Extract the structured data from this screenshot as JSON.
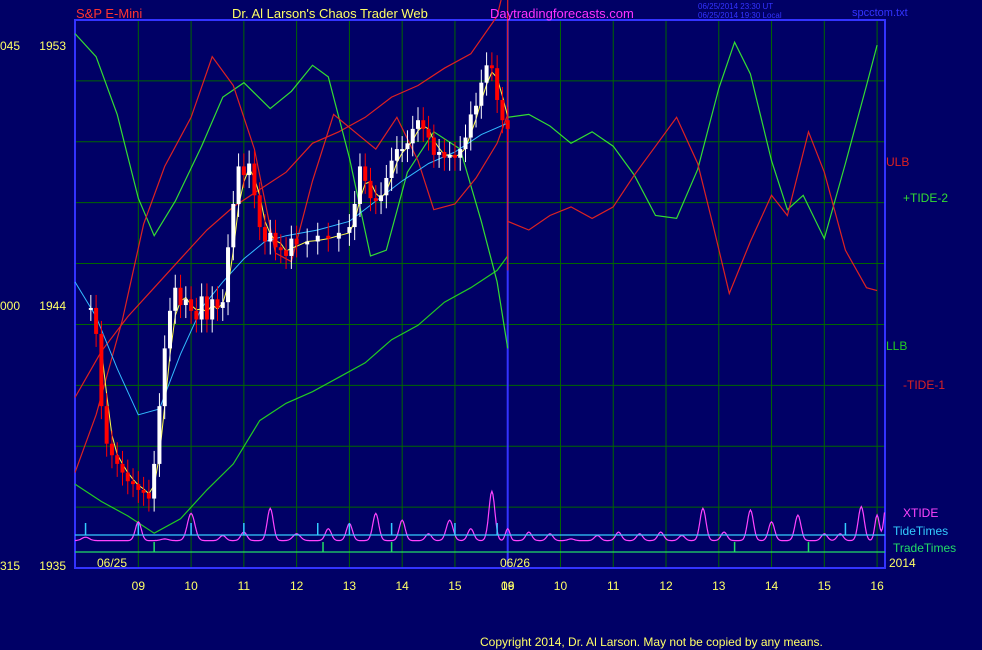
{
  "header": {
    "instrument": "S&P E-Mini",
    "author": "Dr. Al Larson's Chaos Trader Web",
    "site": "Daytradingforecasts.com",
    "stamp_line1": "06/25/2014 23:30 UT",
    "stamp_line2": "06/25/2014 19:30 Local",
    "file": "spcctom.txt"
  },
  "footer": {
    "copyright": "Copyright 2014, Dr. Al Larson. May not be copied by any means."
  },
  "colors": {
    "background": "#000066",
    "grid": "#006600",
    "frame": "#3333ff",
    "title_red": "#ff3333",
    "title_yellow": "#ffff66",
    "site_magenta": "#ff33ff",
    "ulb": "#e02020",
    "llb": "#22cc22",
    "tide_plus": "#33dd33",
    "tide_minus": "#dd2222",
    "xtide": "#ff44ff",
    "tide_times": "#33ccff",
    "trade_times": "#22dd66",
    "ma": "#33bbff",
    "ma_short": "#ffff44",
    "price_up": "#ffffff",
    "price_down": "#ff0000"
  },
  "chart_data": {
    "type": "line",
    "y_ticks": [
      {
        "price": 1953,
        "pre": "045",
        "label": "1953"
      },
      {
        "price": 1944,
        "pre": "000",
        "label": "1944"
      },
      {
        "price": 1935,
        "pre": "315",
        "label": "1935"
      }
    ],
    "ylim": [
      1935,
      1953.8
    ],
    "x_ticks": [
      "09",
      "10",
      "11",
      "12",
      "13",
      "14",
      "15",
      "16",
      "09",
      "10",
      "11",
      "12",
      "13",
      "14",
      "15",
      "16"
    ],
    "date_labels": [
      "06/25",
      "06/26",
      "2014"
    ],
    "series_labels": {
      "ulb": "ULB",
      "tide_plus": "+TIDE-2",
      "llb": "LLB",
      "tide_minus": "-TIDE-1",
      "xtide": "XTIDE",
      "tide_times": "TideTimes",
      "trade_times": "TradeTimes"
    },
    "price_close": [
      [
        8.1,
        1943.9
      ],
      [
        8.2,
        1943.0
      ],
      [
        8.3,
        1940.5
      ],
      [
        8.4,
        1939.2
      ],
      [
        8.5,
        1938.8
      ],
      [
        8.6,
        1938.5
      ],
      [
        8.7,
        1938.2
      ],
      [
        8.8,
        1937.9
      ],
      [
        8.9,
        1937.8
      ],
      [
        9.0,
        1937.6
      ],
      [
        9.1,
        1937.5
      ],
      [
        9.2,
        1937.3
      ],
      [
        9.3,
        1938.5
      ],
      [
        9.4,
        1940.5
      ],
      [
        9.5,
        1942.5
      ],
      [
        9.6,
        1943.8
      ],
      [
        9.7,
        1944.6
      ],
      [
        9.8,
        1944.0
      ],
      [
        9.9,
        1944.2
      ],
      [
        10.0,
        1943.8
      ],
      [
        10.1,
        1943.5
      ],
      [
        10.2,
        1944.3
      ],
      [
        10.3,
        1943.5
      ],
      [
        10.4,
        1944.2
      ],
      [
        10.5,
        1943.9
      ],
      [
        10.6,
        1944.1
      ],
      [
        10.7,
        1946.0
      ],
      [
        10.8,
        1947.5
      ],
      [
        10.9,
        1948.8
      ],
      [
        11.0,
        1948.5
      ],
      [
        11.1,
        1948.9
      ],
      [
        11.2,
        1947.8
      ],
      [
        11.3,
        1946.7
      ],
      [
        11.4,
        1946.2
      ],
      [
        11.5,
        1946.5
      ],
      [
        11.6,
        1946.0
      ],
      [
        11.7,
        1945.9
      ],
      [
        11.8,
        1945.7
      ],
      [
        11.9,
        1946.3
      ],
      [
        12.0,
        1946.1
      ],
      [
        12.2,
        1946.2
      ],
      [
        12.4,
        1946.4
      ],
      [
        12.6,
        1946.3
      ],
      [
        12.8,
        1946.5
      ],
      [
        13.0,
        1946.7
      ],
      [
        13.1,
        1947.5
      ],
      [
        13.2,
        1948.8
      ],
      [
        13.3,
        1948.3
      ],
      [
        13.4,
        1947.7
      ],
      [
        13.5,
        1947.6
      ],
      [
        13.6,
        1947.8
      ],
      [
        13.7,
        1948.4
      ],
      [
        13.8,
        1949.0
      ],
      [
        13.9,
        1949.4
      ],
      [
        14.0,
        1949.4
      ],
      [
        14.1,
        1949.6
      ],
      [
        14.2,
        1950.1
      ],
      [
        14.3,
        1950.4
      ],
      [
        14.4,
        1950.1
      ],
      [
        14.5,
        1949.8
      ],
      [
        14.6,
        1949.2
      ],
      [
        14.7,
        1949.3
      ],
      [
        14.8,
        1949.1
      ],
      [
        14.9,
        1949.2
      ],
      [
        15.0,
        1949.1
      ],
      [
        15.1,
        1949.4
      ],
      [
        15.2,
        1949.8
      ],
      [
        15.3,
        1950.6
      ],
      [
        15.4,
        1950.9
      ],
      [
        15.5,
        1951.7
      ],
      [
        15.6,
        1952.3
      ],
      [
        15.7,
        1952.2
      ],
      [
        15.8,
        1951.1
      ],
      [
        15.9,
        1950.4
      ],
      [
        16.0,
        1950.1
      ]
    ],
    "ma": [
      [
        7.8,
        1944.8
      ],
      [
        8.2,
        1943.6
      ],
      [
        8.6,
        1941.8
      ],
      [
        9.0,
        1940.2
      ],
      [
        9.4,
        1940.4
      ],
      [
        9.8,
        1942.3
      ],
      [
        10.2,
        1943.9
      ],
      [
        10.6,
        1944.8
      ],
      [
        11.0,
        1945.6
      ],
      [
        11.4,
        1946.2
      ],
      [
        11.8,
        1946.4
      ],
      [
        12.4,
        1946.6
      ],
      [
        13.0,
        1946.9
      ],
      [
        13.5,
        1947.6
      ],
      [
        14.0,
        1948.3
      ],
      [
        14.5,
        1948.9
      ],
      [
        15.0,
        1949.3
      ],
      [
        15.5,
        1949.9
      ],
      [
        16.0,
        1950.3
      ]
    ],
    "ulb": [
      [
        7.8,
        1940.8
      ],
      [
        8.3,
        1942.4
      ],
      [
        8.8,
        1943.6
      ],
      [
        9.3,
        1944.6
      ],
      [
        9.8,
        1945.6
      ],
      [
        10.3,
        1946.6
      ],
      [
        10.8,
        1947.4
      ],
      [
        11.3,
        1948.0
      ],
      [
        11.8,
        1948.6
      ],
      [
        12.3,
        1949.6
      ],
      [
        12.8,
        1950.0
      ],
      [
        13.3,
        1950.5
      ],
      [
        13.8,
        1951.2
      ],
      [
        14.3,
        1951.6
      ],
      [
        14.8,
        1952.2
      ],
      [
        15.3,
        1952.7
      ],
      [
        15.8,
        1954.0
      ],
      [
        16.0,
        1955.5
      ]
    ],
    "llb": [
      [
        7.8,
        1937.8
      ],
      [
        8.3,
        1937.2
      ],
      [
        8.8,
        1936.7
      ],
      [
        9.3,
        1936.1
      ],
      [
        9.8,
        1936.6
      ],
      [
        10.3,
        1937.6
      ],
      [
        10.8,
        1938.5
      ],
      [
        11.3,
        1940.0
      ],
      [
        11.8,
        1940.6
      ],
      [
        12.3,
        1941.0
      ],
      [
        12.8,
        1941.5
      ],
      [
        13.3,
        1942.0
      ],
      [
        13.8,
        1942.8
      ],
      [
        14.3,
        1943.3
      ],
      [
        14.8,
        1944.1
      ],
      [
        15.3,
        1944.6
      ],
      [
        15.8,
        1945.2
      ],
      [
        16.0,
        1945.7
      ]
    ],
    "tide_plus": [
      [
        7.8,
        1953.4
      ],
      [
        8.2,
        1952.6
      ],
      [
        8.6,
        1950.6
      ],
      [
        9.0,
        1947.7
      ],
      [
        9.3,
        1946.4
      ],
      [
        9.7,
        1947.6
      ],
      [
        10.2,
        1949.5
      ],
      [
        10.6,
        1951.2
      ],
      [
        11.0,
        1951.7
      ],
      [
        11.5,
        1950.8
      ],
      [
        11.9,
        1951.4
      ],
      [
        12.3,
        1952.3
      ],
      [
        12.6,
        1951.9
      ],
      [
        13.0,
        1949.1
      ],
      [
        13.4,
        1945.7
      ],
      [
        13.7,
        1945.9
      ],
      [
        14.1,
        1948.6
      ],
      [
        14.6,
        1950.0
      ],
      [
        15.1,
        1949.4
      ],
      [
        15.5,
        1946.9
      ],
      [
        15.8,
        1944.8
      ],
      [
        16.0,
        1942.5
      ]
    ],
    "tide_minus": [
      [
        7.8,
        1938.2
      ],
      [
        8.2,
        1940.2
      ],
      [
        8.7,
        1943.5
      ],
      [
        9.1,
        1946.8
      ],
      [
        9.5,
        1948.8
      ],
      [
        10.0,
        1950.5
      ],
      [
        10.4,
        1952.6
      ],
      [
        10.8,
        1951.6
      ],
      [
        11.2,
        1949.4
      ],
      [
        11.6,
        1945.8
      ],
      [
        11.9,
        1945.5
      ],
      [
        12.3,
        1948.3
      ],
      [
        12.7,
        1950.6
      ],
      [
        13.1,
        1950.0
      ],
      [
        13.5,
        1949.4
      ],
      [
        13.9,
        1950.5
      ],
      [
        14.3,
        1949.0
      ],
      [
        14.6,
        1947.3
      ],
      [
        15.0,
        1947.5
      ],
      [
        15.4,
        1948.4
      ],
      [
        15.8,
        1949.6
      ],
      [
        16.0,
        1950.6
      ]
    ],
    "tide_plus_future": [
      [
        16.0,
        1950.5
      ],
      [
        16.4,
        1950.6
      ],
      [
        16.8,
        1950.2
      ],
      [
        17.2,
        1949.6
      ],
      [
        17.6,
        1950.0
      ],
      [
        18.0,
        1949.5
      ],
      [
        18.4,
        1948.5
      ],
      [
        18.8,
        1947.1
      ],
      [
        19.2,
        1947.0
      ],
      [
        19.6,
        1948.7
      ],
      [
        20.0,
        1951.5
      ],
      [
        20.3,
        1953.1
      ],
      [
        20.6,
        1952.0
      ],
      [
        21.0,
        1949.0
      ],
      [
        21.3,
        1947.3
      ],
      [
        21.6,
        1947.8
      ],
      [
        22.0,
        1946.3
      ],
      [
        22.4,
        1948.9
      ],
      [
        22.8,
        1951.6
      ],
      [
        23.0,
        1953.0
      ]
    ],
    "tide_minus_future": [
      [
        16.0,
        1946.9
      ],
      [
        16.4,
        1946.6
      ],
      [
        16.8,
        1947.1
      ],
      [
        17.2,
        1947.4
      ],
      [
        17.6,
        1947.0
      ],
      [
        18.0,
        1947.4
      ],
      [
        18.4,
        1948.5
      ],
      [
        18.8,
        1949.5
      ],
      [
        19.2,
        1950.5
      ],
      [
        19.6,
        1948.9
      ],
      [
        19.9,
        1946.7
      ],
      [
        20.2,
        1944.4
      ],
      [
        20.6,
        1946.2
      ],
      [
        21.0,
        1947.8
      ],
      [
        21.3,
        1947.1
      ],
      [
        21.7,
        1950.0
      ],
      [
        22.0,
        1948.6
      ],
      [
        22.4,
        1945.9
      ],
      [
        22.8,
        1944.6
      ],
      [
        23.0,
        1944.5
      ]
    ],
    "xtide_peaks": [
      [
        8.0,
        0.1,
        0.1
      ],
      [
        8.5,
        0.0,
        0.1
      ],
      [
        9.0,
        0.55,
        0.08
      ],
      [
        9.5,
        0.05,
        0.1
      ],
      [
        10.0,
        0.8,
        0.1
      ],
      [
        10.6,
        0.15,
        0.08
      ],
      [
        11.0,
        0.25,
        0.08
      ],
      [
        11.5,
        0.95,
        0.08
      ],
      [
        12.0,
        0.2,
        0.1
      ],
      [
        12.6,
        0.35,
        0.08
      ],
      [
        13.0,
        0.5,
        0.08
      ],
      [
        13.5,
        0.8,
        0.08
      ],
      [
        14.0,
        0.6,
        0.08
      ],
      [
        14.5,
        0.2,
        0.08
      ],
      [
        14.9,
        0.6,
        0.09
      ],
      [
        15.3,
        0.35,
        0.08
      ],
      [
        15.7,
        1.45,
        0.08
      ],
      [
        16.0,
        0.35,
        0.06
      ],
      [
        16.4,
        0.25,
        0.08
      ],
      [
        16.8,
        0.2,
        0.08
      ],
      [
        17.2,
        0.05,
        0.08
      ],
      [
        17.7,
        0.15,
        0.08
      ],
      [
        18.1,
        0.25,
        0.08
      ],
      [
        18.5,
        0.2,
        0.08
      ],
      [
        18.9,
        0.25,
        0.08
      ],
      [
        19.3,
        0.15,
        0.08
      ],
      [
        19.7,
        0.95,
        0.08
      ],
      [
        20.1,
        0.25,
        0.08
      ],
      [
        20.6,
        0.9,
        0.08
      ],
      [
        21.0,
        0.55,
        0.08
      ],
      [
        21.5,
        0.75,
        0.08
      ],
      [
        22.0,
        0.2,
        0.08
      ],
      [
        22.3,
        0.2,
        0.08
      ],
      [
        22.7,
        1.0,
        0.08
      ],
      [
        23.0,
        0.75,
        0.06
      ],
      [
        23.2,
        1.45,
        0.08
      ]
    ],
    "tide_times": [
      8.0,
      9.0,
      10.0,
      11.0,
      12.4,
      13.0,
      13.8,
      15.0,
      15.8,
      22.4
    ],
    "trade_times": [
      9.3,
      12.5,
      13.8,
      20.3,
      21.7
    ]
  }
}
